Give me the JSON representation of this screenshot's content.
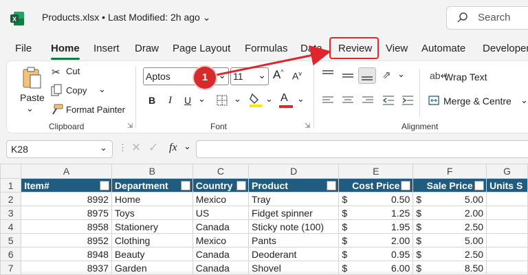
{
  "titlebar": {
    "file_name": "Products.xlsx",
    "separator": "•",
    "status": "Last Modified: 2h ago"
  },
  "search": {
    "placeholder": "Search"
  },
  "tabs": [
    "File",
    "Home",
    "Insert",
    "Draw",
    "Page Layout",
    "Formulas",
    "Data",
    "Review",
    "View",
    "Automate",
    "Developer"
  ],
  "ribbon": {
    "clipboard": {
      "paste": "Paste",
      "cut": "Cut",
      "copy": "Copy",
      "format_painter": "Format Painter",
      "group": "Clipboard"
    },
    "font": {
      "name": "Aptos",
      "size": "11",
      "bold": "B",
      "italic": "I",
      "underline": "U",
      "group": "Font"
    },
    "alignment": {
      "wrap_text": "Wrap Text",
      "merge_centre": "Merge & Centre",
      "group": "Alignment"
    }
  },
  "formula_bar": {
    "name_box": "K28",
    "fx": "fx",
    "value": ""
  },
  "annotation": {
    "badge": "1",
    "highlight_color": "#e0262d"
  },
  "sheet": {
    "columns": [
      "A",
      "B",
      "C",
      "D",
      "E",
      "F",
      "G"
    ],
    "headers": [
      "Item#",
      "Department",
      "Country",
      "Product",
      "Cost Price",
      "Sale Price",
      "Units S"
    ],
    "rows": [
      {
        "num": "1"
      },
      {
        "num": "2",
        "item": "8992",
        "dept": "Home",
        "country": "Mexico",
        "product": "Tray",
        "cost": "0.50",
        "sale": "5.00"
      },
      {
        "num": "3",
        "item": "8975",
        "dept": "Toys",
        "country": "US",
        "product": "Fidget spinner",
        "cost": "1.25",
        "sale": "2.00"
      },
      {
        "num": "4",
        "item": "8958",
        "dept": "Stationery",
        "country": "Canada",
        "product": "Sticky note (100)",
        "cost": "1.95",
        "sale": "2.50"
      },
      {
        "num": "5",
        "item": "8952",
        "dept": "Clothing",
        "country": "Mexico",
        "product": "Pants",
        "cost": "2.00",
        "sale": "5.00"
      },
      {
        "num": "6",
        "item": "8948",
        "dept": "Beauty",
        "country": "Canada",
        "product": "Deoderant",
        "cost": "0.95",
        "sale": "2.50"
      },
      {
        "num": "7",
        "item": "8937",
        "dept": "Garden",
        "country": "Canada",
        "product": "Shovel",
        "cost": "6.00",
        "sale": "8.50"
      }
    ],
    "currency": "$",
    "header_color": "#1f5c80"
  }
}
